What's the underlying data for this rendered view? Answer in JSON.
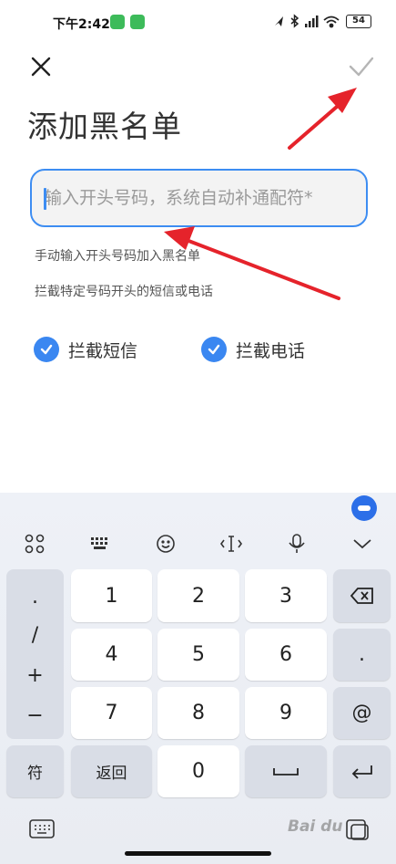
{
  "status_bar": {
    "time": "下午2:42",
    "battery": "54"
  },
  "header": {
    "title": "添加黑名单"
  },
  "form": {
    "placeholder": "输入开头号码，系统自动补通配符*",
    "value": "",
    "hint_1": "手动输入开头号码加入黑名单",
    "hint_2": "拦截特定号码开头的短信或电话",
    "check_sms_label": "拦截短信",
    "check_call_label": "拦截电话"
  },
  "keyboard": {
    "symbols": [
      ".",
      "/",
      "+",
      "−"
    ],
    "keys": [
      "1",
      "2",
      "3",
      "4",
      "5",
      "6",
      "7",
      "8",
      "9",
      "0"
    ],
    "dot": ".",
    "at": "@",
    "sym_label": "符",
    "back_label": "返回"
  },
  "watermark": "Bai du"
}
